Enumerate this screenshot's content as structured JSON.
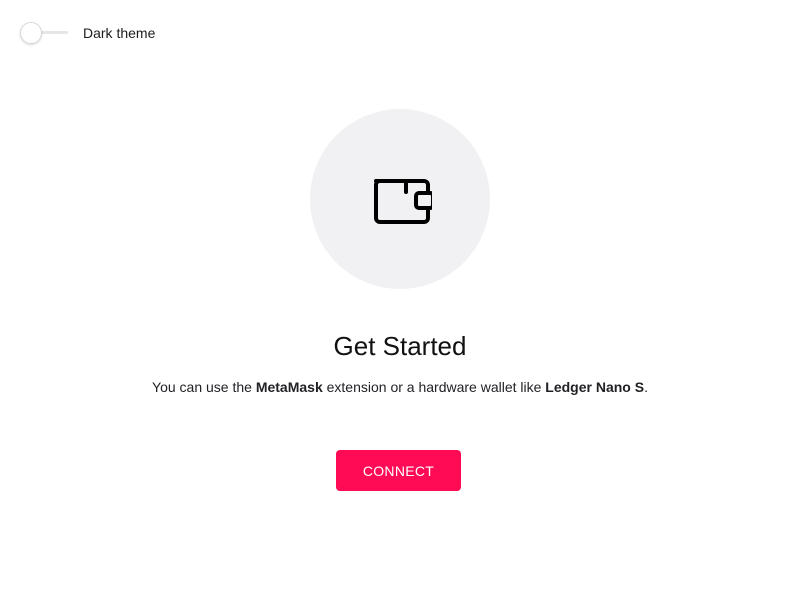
{
  "theme_toggle": {
    "label": "Dark theme",
    "checked": false
  },
  "hero": {
    "icon": "wallet-icon",
    "title": "Get Started",
    "description": {
      "part1": "You can use the ",
      "highlight1": "MetaMask",
      "part2": " extension or a hardware wallet like ",
      "highlight2": "Ledger Nano S",
      "part3": "."
    }
  },
  "connect_button": {
    "label": "CONNECT"
  },
  "colors": {
    "accent": "#ff0a54",
    "circle_background": "#f1f1f3",
    "text": "#1c1c1e"
  }
}
